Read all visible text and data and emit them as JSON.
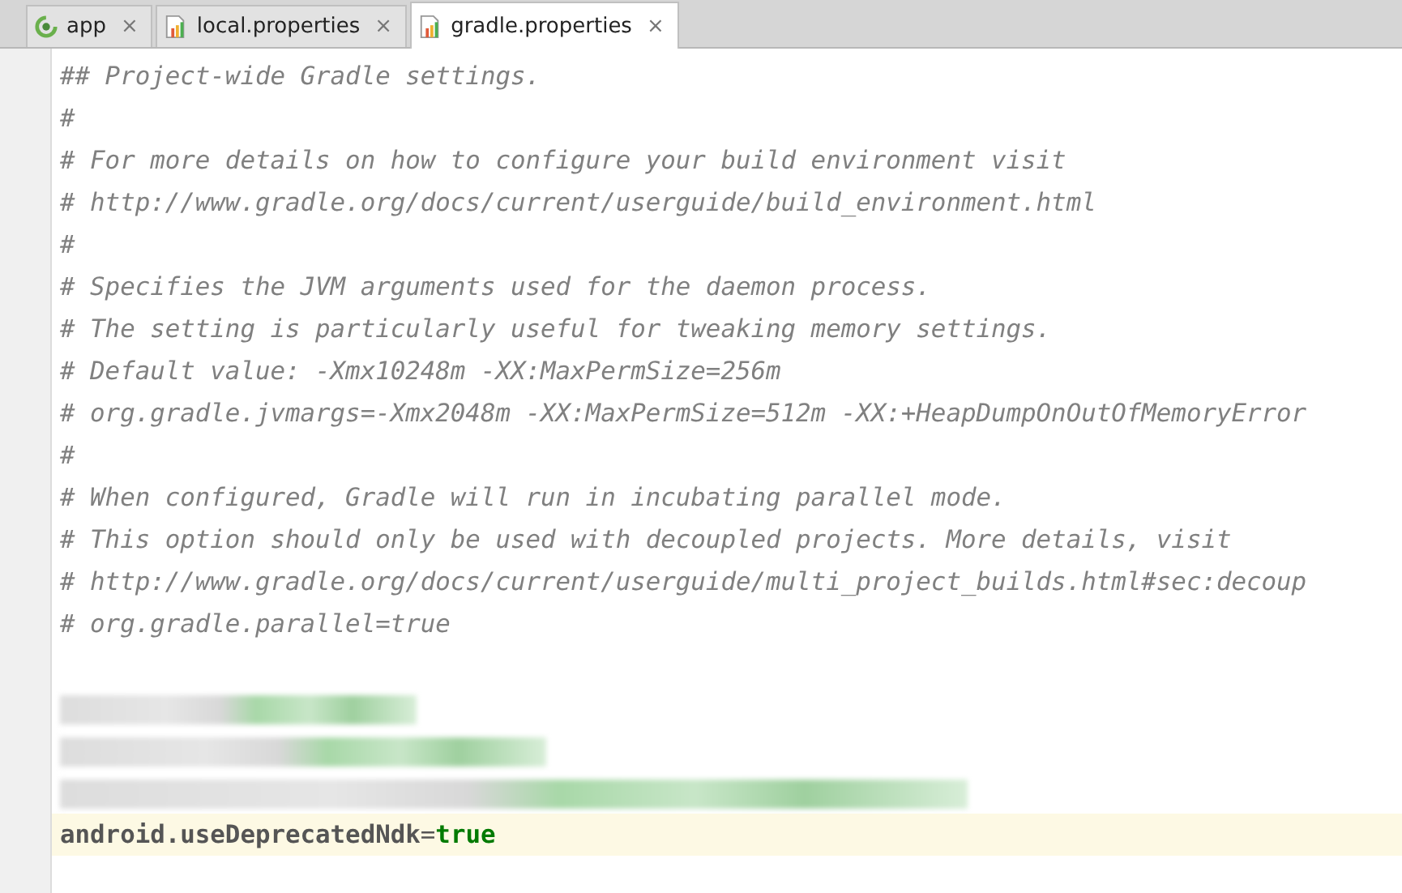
{
  "tabs": [
    {
      "label": "app",
      "kind": "module",
      "selected": false
    },
    {
      "label": "local.properties",
      "kind": "properties",
      "selected": false
    },
    {
      "label": "gradle.properties",
      "kind": "properties",
      "selected": true
    }
  ],
  "close_symbol": "×",
  "lines": [
    {
      "kind": "comment",
      "text": "## Project-wide Gradle settings."
    },
    {
      "kind": "comment",
      "text": "#"
    },
    {
      "kind": "comment",
      "text": "# For more details on how to configure your build environment visit"
    },
    {
      "kind": "comment",
      "text": "# http://www.gradle.org/docs/current/userguide/build_environment.html"
    },
    {
      "kind": "comment",
      "text": "#"
    },
    {
      "kind": "comment",
      "text": "# Specifies the JVM arguments used for the daemon process."
    },
    {
      "kind": "comment",
      "text": "# The setting is particularly useful for tweaking memory settings."
    },
    {
      "kind": "comment",
      "text": "# Default value: -Xmx10248m -XX:MaxPermSize=256m"
    },
    {
      "kind": "comment",
      "text": "# org.gradle.jvmargs=-Xmx2048m -XX:MaxPermSize=512m -XX:+HeapDumpOnOutOfMemoryError"
    },
    {
      "kind": "comment",
      "text": "#"
    },
    {
      "kind": "comment",
      "text": "# When configured, Gradle will run in incubating parallel mode."
    },
    {
      "kind": "comment",
      "text": "# This option should only be used with decoupled projects. More details, visit"
    },
    {
      "kind": "comment",
      "text": "# http://www.gradle.org/docs/current/userguide/multi_project_builds.html#sec:decoup"
    },
    {
      "kind": "comment",
      "text": "# org.gradle.parallel=true"
    },
    {
      "kind": "blank"
    },
    {
      "kind": "redacted"
    },
    {
      "kind": "redacted"
    },
    {
      "kind": "redacted"
    },
    {
      "kind": "property",
      "key": "android.useDeprecatedNdk",
      "sep": "=",
      "value": "true",
      "current": true
    }
  ]
}
